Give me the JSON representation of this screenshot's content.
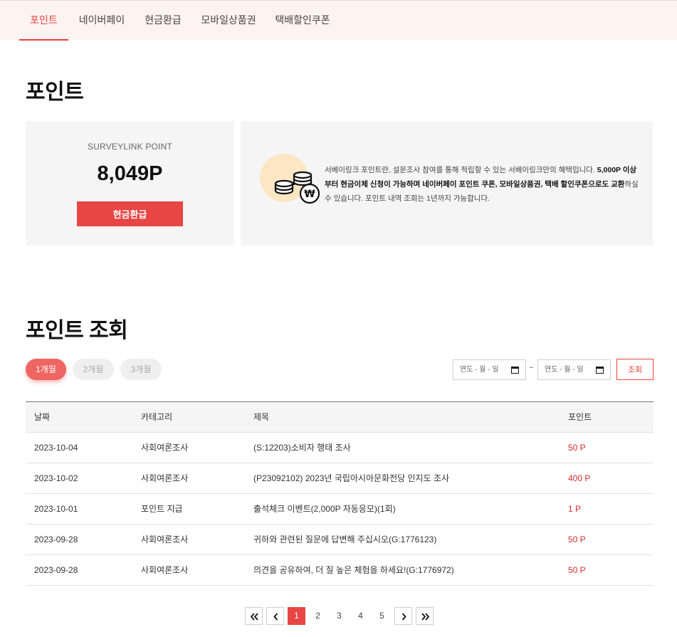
{
  "nav": {
    "tabs": [
      {
        "label": "포인트"
      },
      {
        "label": "네이버페이"
      },
      {
        "label": "현금환급"
      },
      {
        "label": "모바일상품권"
      },
      {
        "label": "택배할인쿠폰"
      }
    ]
  },
  "point_section": {
    "title": "포인트",
    "card_label": "SURVEYLINK POINT",
    "card_value": "8,049P",
    "refund_button": "현금환급",
    "coin_icon": "coins-won-icon",
    "desc_part1": "서베이링크 포인트란, 설문조사 참여를 통해 적립할 수 있는 서베이링크만의 혜택입니다. ",
    "desc_bold1": "5,000P 이상부터 현금이체 신청이 가능하며 네이버페이 포인트 쿠폰, 모바일상품권, 택배 할인쿠폰으로도 교환",
    "desc_part2": "하실 수 있습니다. 포인트 내역 조회는 1년까지 가능합니다."
  },
  "history_section": {
    "title": "포인트 조회",
    "periods": [
      {
        "label": "1개월"
      },
      {
        "label": "2개월"
      },
      {
        "label": "3개월"
      }
    ],
    "date_from_placeholder": "연도 - 월 - 일",
    "date_to_placeholder": "연도 - 월 - 일",
    "tilde": "~",
    "search_button": "조회"
  },
  "table": {
    "headers": [
      "날짜",
      "카테고리",
      "제목",
      "포인트"
    ],
    "rows": [
      [
        "2023-10-04",
        "사회여론조사",
        "(S:12203)소비자 행태 조사",
        "50 P"
      ],
      [
        "2023-10-02",
        "사회여론조사",
        "(P23092102) 2023년 국립아시아문화전당 인지도 조사",
        "400 P"
      ],
      [
        "2023-10-01",
        "포인트 지급",
        "출석체크 이벤트(2,000P 자동응모)(1회)",
        "1 P"
      ],
      [
        "2023-09-28",
        "사회여론조사",
        "귀하와 관련된 질문에 답변해 주십시오(G:1776123)",
        "50 P"
      ],
      [
        "2023-09-28",
        "사회여론조사",
        "의견을 공유하여, 더 질 높은 체험을 하세요!(G:1776972)",
        "50 P"
      ]
    ]
  },
  "pagination": {
    "pages": [
      "1",
      "2",
      "3",
      "4",
      "5"
    ],
    "current": "1"
  },
  "colors": {
    "accent": "#e8413b",
    "nav_bg": "#fdf3f1",
    "card_bg": "#f5f5f5"
  }
}
